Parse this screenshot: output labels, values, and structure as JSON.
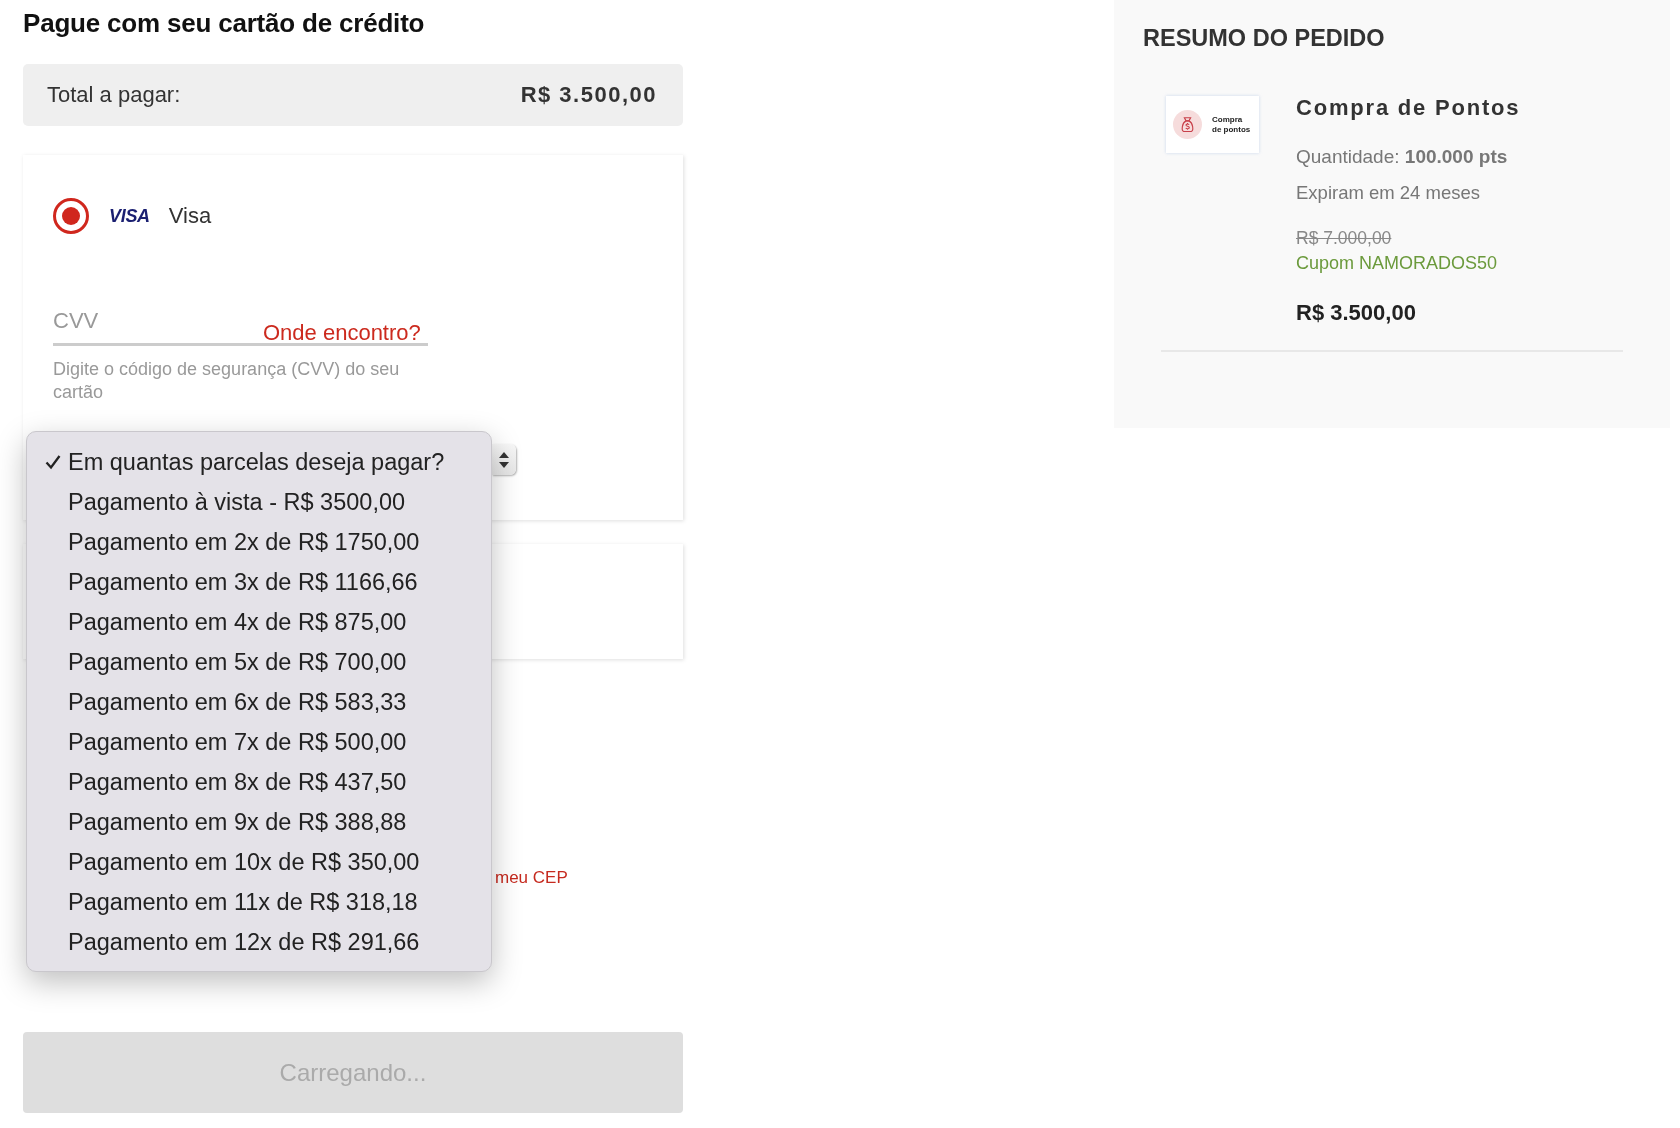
{
  "payment": {
    "title": "Pague com seu cartão de crédito",
    "total": {
      "label": "Total a pagar:",
      "value": "R$ 3.500,00"
    },
    "method": {
      "logo": "VISA",
      "label": "Visa",
      "selected": true
    },
    "cvv": {
      "placeholder": "CVV",
      "help_link": "Onde encontro?",
      "hint": "Digite o código de segurança (CVV) do seu cartão"
    },
    "installments": {
      "expanded": true,
      "options": [
        {
          "label": "Em quantas parcelas deseja pagar?",
          "selected": true
        },
        {
          "label": "Pagamento à vista - R$ 3500,00",
          "selected": false
        },
        {
          "label": "Pagamento em 2x de R$ 1750,00",
          "selected": false
        },
        {
          "label": "Pagamento em 3x de R$ 1166,66",
          "selected": false
        },
        {
          "label": "Pagamento em 4x de R$ 875,00",
          "selected": false
        },
        {
          "label": "Pagamento em 5x de R$ 700,00",
          "selected": false
        },
        {
          "label": "Pagamento em 6x de R$ 583,33",
          "selected": false
        },
        {
          "label": "Pagamento em 7x de R$ 500,00",
          "selected": false
        },
        {
          "label": "Pagamento em 8x de R$ 437,50",
          "selected": false
        },
        {
          "label": "Pagamento em 9x de R$ 388,88",
          "selected": false
        },
        {
          "label": "Pagamento em 10x de R$ 350,00",
          "selected": false
        },
        {
          "label": "Pagamento em 11x de R$ 318,18",
          "selected": false
        },
        {
          "label": "Pagamento em 12x de R$ 291,66",
          "selected": false
        }
      ]
    },
    "cep_link": "meu CEP",
    "submit": {
      "label": "Carregando...",
      "disabled": true
    }
  },
  "summary": {
    "title": "RESUMO DO PEDIDO",
    "items": [
      {
        "thumbnail_caption": "Compra de pontos",
        "name": "Compra de Pontos",
        "quantity": "Quantidade: **100.000 pts**",
        "expiry": "Expiram em 24 meses",
        "original_price": "R$ 7.000,00",
        "coupon": "Cupom NAMORADOS50",
        "price": "R$ 3.500,00"
      }
    ]
  }
}
